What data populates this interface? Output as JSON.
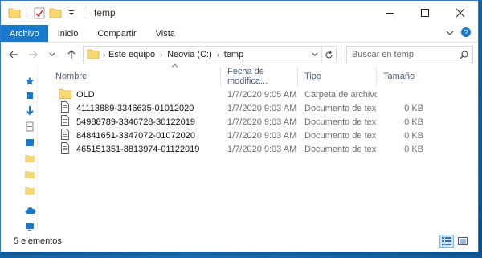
{
  "window": {
    "title": "temp",
    "controls": [
      "minimize-icon",
      "maximize-icon",
      "close-icon"
    ]
  },
  "ribbon": {
    "tabs": [
      {
        "label": "Archivo"
      },
      {
        "label": "Inicio"
      },
      {
        "label": "Compartir"
      },
      {
        "label": "Vista"
      }
    ]
  },
  "address": {
    "breadcrumbs": [
      "Este equipo",
      "Neovia (C:)",
      "temp"
    ]
  },
  "search": {
    "placeholder": "Buscar en temp"
  },
  "columns": {
    "name": "Nombre",
    "date": "Fecha de modifica...",
    "type": "Tipo",
    "size": "Tamaño"
  },
  "files": [
    {
      "name": "OLD",
      "date": "1/7/2020 9:05 AM",
      "type": "Carpeta de archivos",
      "size": "",
      "icon": "folder-icon"
    },
    {
      "name": "41113889-3346635-01012020",
      "date": "1/7/2020 9:03 AM",
      "type": "Documento de tex...",
      "size": "0 KB",
      "icon": "document-icon"
    },
    {
      "name": "54988789-3346728-30122019",
      "date": "1/7/2020 9:03 AM",
      "type": "Documento de tex...",
      "size": "0 KB",
      "icon": "document-icon"
    },
    {
      "name": "84841651-3347072-01072020",
      "date": "1/7/2020 9:03 AM",
      "type": "Documento de tex...",
      "size": "0 KB",
      "icon": "document-icon"
    },
    {
      "name": "465151351-8813974-01122019",
      "date": "1/7/2020 9:03 AM",
      "type": "Documento de tex...",
      "size": "0 KB",
      "icon": "document-icon"
    }
  ],
  "status": {
    "count": "5 elementos"
  },
  "colors": {
    "accent": "#1979ca",
    "folder": "#f8d775",
    "header_text": "#4c607a"
  }
}
